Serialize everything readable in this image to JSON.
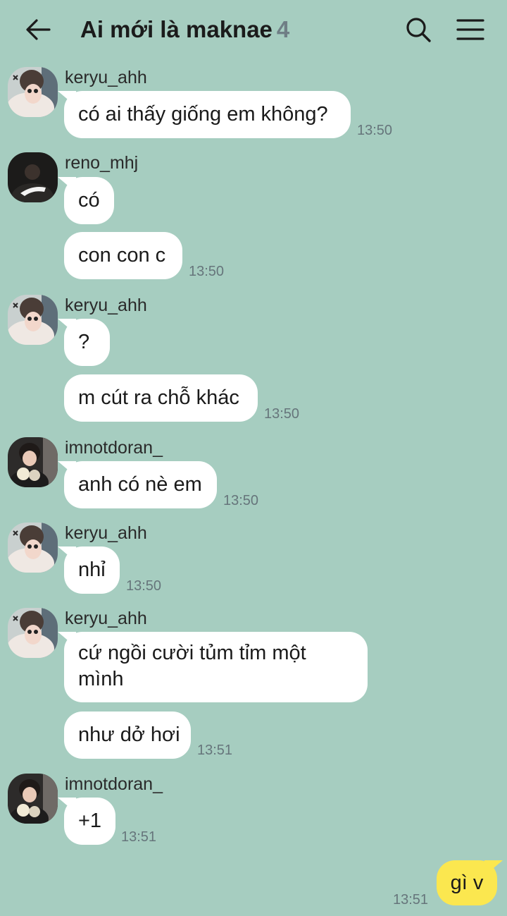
{
  "header": {
    "back_icon": "arrow-left-icon",
    "title": "Ai mới là maknae",
    "member_count": "4",
    "search_icon": "search-icon",
    "menu_icon": "hamburger-menu-icon"
  },
  "colors": {
    "background": "#a6cdc0",
    "incoming_bubble": "#ffffff",
    "outgoing_bubble": "#fbe74f",
    "timestamp": "#66757b",
    "member_count": "#6f7e85"
  },
  "messages": [
    {
      "sender": "keryu_ahh",
      "text": "có ai thấy giống em không?",
      "time": "13:50"
    },
    {
      "sender": "reno_mhj",
      "text": "có",
      "time": ""
    },
    {
      "sender": "reno_mhj",
      "text": "con con c",
      "time": "13:50"
    },
    {
      "sender": "keryu_ahh",
      "text": "?",
      "time": ""
    },
    {
      "sender": "keryu_ahh",
      "text": "m cút ra chỗ khác",
      "time": "13:50"
    },
    {
      "sender": "imnotdoran_",
      "text": "anh có nè em",
      "time": "13:50"
    },
    {
      "sender": "keryu_ahh",
      "text": "nhỉ",
      "time": "13:50"
    },
    {
      "sender": "keryu_ahh",
      "text": "cứ ngồi cười tủm tỉm một mình",
      "time": ""
    },
    {
      "sender": "keryu_ahh",
      "text": "như dở hơi",
      "time": "13:51"
    },
    {
      "sender": "imnotdoran_",
      "text": "+1",
      "time": "13:51"
    }
  ],
  "my_message": {
    "text": "gì v",
    "time": "13:51"
  }
}
